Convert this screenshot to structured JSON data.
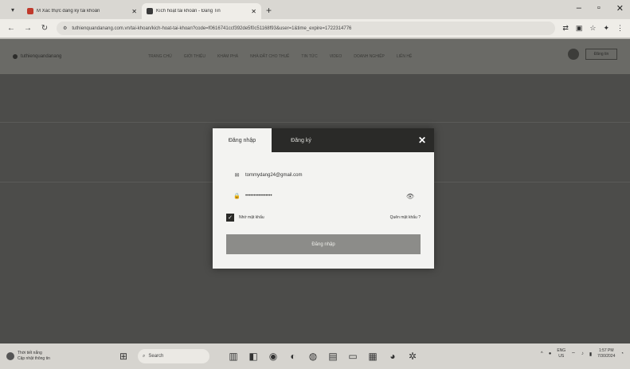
{
  "browser": {
    "tabs": [
      {
        "title": "M  Xác thực đăng ký tài khoản",
        "favicon": "gmail-icon",
        "active": false
      },
      {
        "title": "Kích hoạt tài khoản - Đăng Tin",
        "favicon": "site-icon",
        "active": true
      }
    ],
    "url": "tuthienquandanang.com.vn/tai-khoan/kich-hoat-tai-khoan?code=f0616741ccf392de5f0c51168f93&user=1&time_expire=1722314776"
  },
  "site": {
    "logo": "tuthienquandanang",
    "menu": [
      "TRANG CHỦ",
      "GIỚI THIỆU",
      "KHÁM PHÁ",
      "NHÀ ĐẤT CHO THUÊ",
      "TIN TỨC",
      "VIDEO",
      "DOANH NGHIỆP",
      "LIÊN HỆ"
    ],
    "signup_label": "Đăng tin"
  },
  "modal": {
    "tab_login": "Đăng nhập",
    "tab_register": "Đăng ký",
    "email_value": "tommydang24@gmail.com",
    "password_value": "••••••••••••••••",
    "remember_label": "Nhớ mật khẩu",
    "forgot_label": "Quên mật khẩu ?",
    "submit_label": "Đăng nhập"
  },
  "taskbar": {
    "weather_line1": "Thời tiết nắng",
    "weather_line2": "Cập nhật thông tin",
    "search_label": "Search",
    "lang_line1": "ENG",
    "lang_line2": "US",
    "time": "1:57 PM",
    "date": "7/30/2024"
  }
}
